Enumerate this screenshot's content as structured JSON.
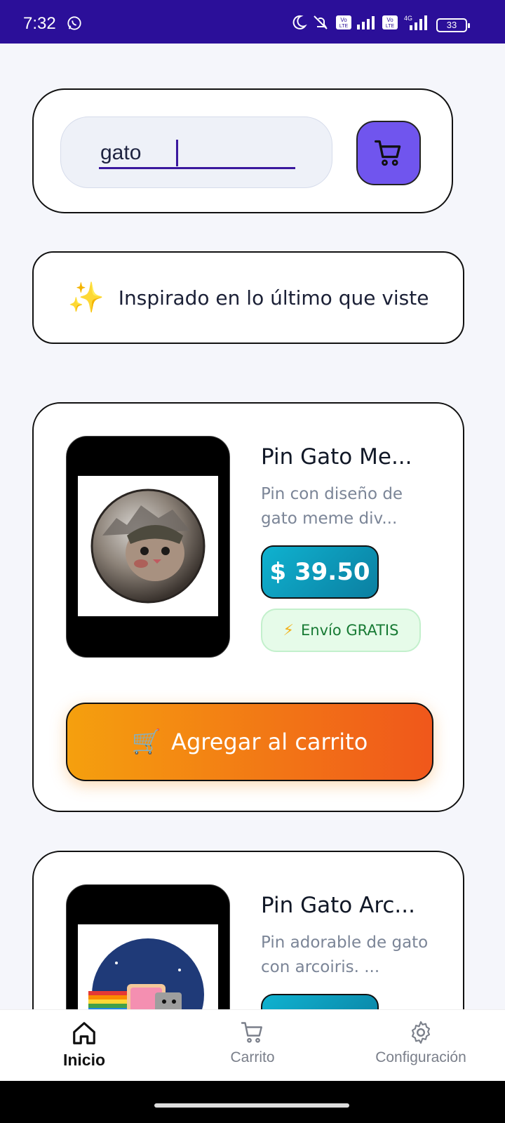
{
  "status_bar": {
    "time": "7:32",
    "battery": "33"
  },
  "search": {
    "value": "gato"
  },
  "banner": {
    "icon": "✨",
    "text": "Inspirado en lo último que viste"
  },
  "products": [
    {
      "title": "Pin Gato Me...",
      "description": "Pin con diseño de gato meme div...",
      "price": "$ 39.50",
      "shipping": "Envío GRATIS",
      "add_to_cart": "Agregar al carrito"
    },
    {
      "title": "Pin Gato Arc...",
      "description": "Pin adorable de gato con arcoiris. ..."
    }
  ],
  "nav": {
    "items": [
      {
        "label": "Inicio",
        "icon": "home-icon",
        "active": true
      },
      {
        "label": "Carrito",
        "icon": "cart-icon",
        "active": false
      },
      {
        "label": "Configuración",
        "icon": "gear-icon",
        "active": false
      }
    ]
  },
  "colors": {
    "status_bar": "#2b0f99",
    "accent": "#7055ee",
    "price": "#0fb2d0",
    "cta_start": "#f5a00e",
    "cta_end": "#f0571b",
    "shipping_text": "#177a34"
  }
}
